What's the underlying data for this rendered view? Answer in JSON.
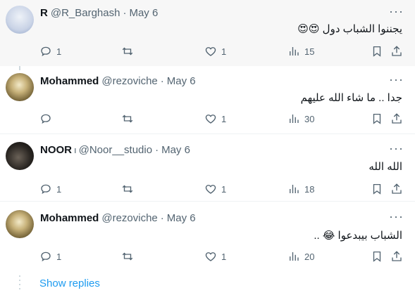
{
  "tweets": [
    {
      "name": "R",
      "handle": "@R_Barghash",
      "date": "May 6",
      "text": "يجننوا الشباب دول 😍😍",
      "replies": "1",
      "retweets": "",
      "likes": "1",
      "views": "15"
    },
    {
      "name": "Mohammed",
      "handle": "@rezoviche",
      "date": "May 6",
      "text": "جدا .. ما شاء الله عليهم",
      "replies": "",
      "retweets": "",
      "likes": "1",
      "views": "30"
    },
    {
      "name": "NOOR",
      "name_suffix": "ı",
      "handle": "@Noor__studio",
      "date": "May 6",
      "text": "الله الله",
      "replies": "1",
      "retweets": "",
      "likes": "1",
      "views": "18"
    },
    {
      "name": "Mohammed",
      "handle": "@rezoviche",
      "date": "May 6",
      "text": "الشباب بيبدعوا 😂 ..",
      "replies": "1",
      "retweets": "",
      "likes": "1",
      "views": "20"
    }
  ],
  "separator": "·",
  "more_glyph": "···",
  "show_replies_label": "Show replies",
  "colors": {
    "link": "#1d9bf0",
    "muted": "#536471",
    "text": "#0f1419",
    "highlight_bg": "#f7f7f7"
  },
  "icons": [
    "reply-icon",
    "retweet-icon",
    "like-icon",
    "views-icon",
    "bookmark-icon",
    "share-icon"
  ]
}
